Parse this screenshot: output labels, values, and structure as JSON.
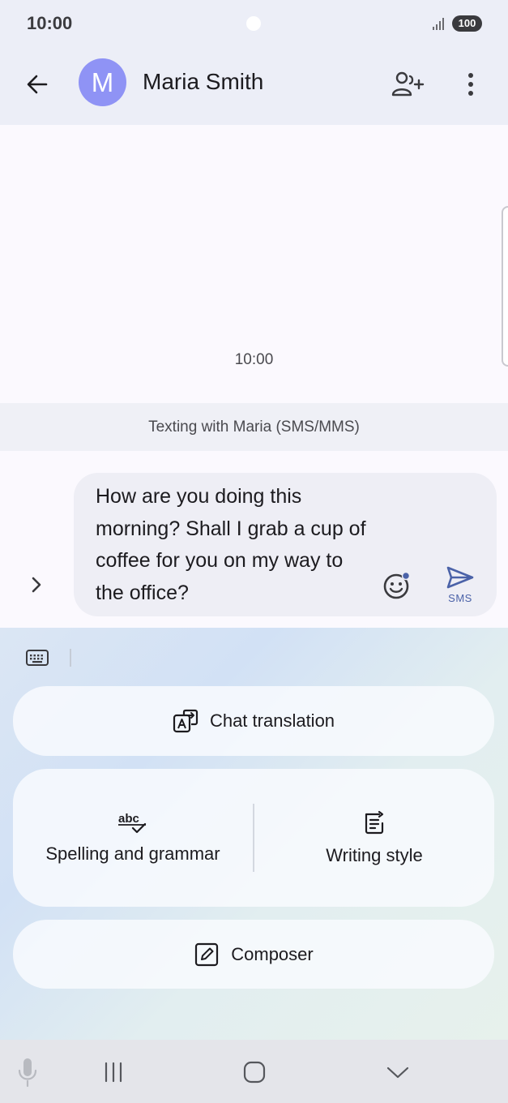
{
  "status_bar": {
    "time": "10:00",
    "battery": "100"
  },
  "header": {
    "avatar_initial": "M",
    "contact_name": "Maria Smith"
  },
  "conversation": {
    "timestamp": "10:00"
  },
  "banner": {
    "text": "Texting with Maria (SMS/MMS)"
  },
  "composer": {
    "message_text": "How are you doing this morning? Shall I grab a cup of coffee for you on my way to the office?",
    "send_label": "SMS"
  },
  "writing_assist": {
    "chat_translation_label": "Chat translation",
    "spelling_grammar_label": "Spelling and grammar",
    "spelling_grammar_icon_text": "abc",
    "writing_style_label": "Writing style",
    "composer_label": "Composer"
  },
  "colors": {
    "avatar": "#8f93f5",
    "header_bg": "#eceef7",
    "send_accent": "#4b62a8"
  },
  "icons": [
    "signal-icon",
    "back-arrow-icon",
    "add-contact-icon",
    "more-vert-icon",
    "chevron-right-icon",
    "emoji-icon",
    "send-icon",
    "keyboard-icon",
    "translate-icon",
    "spellcheck-icon",
    "writing-style-icon",
    "edit-icon",
    "mic-icon",
    "recents-icon",
    "home-icon",
    "hide-keyboard-icon"
  ]
}
